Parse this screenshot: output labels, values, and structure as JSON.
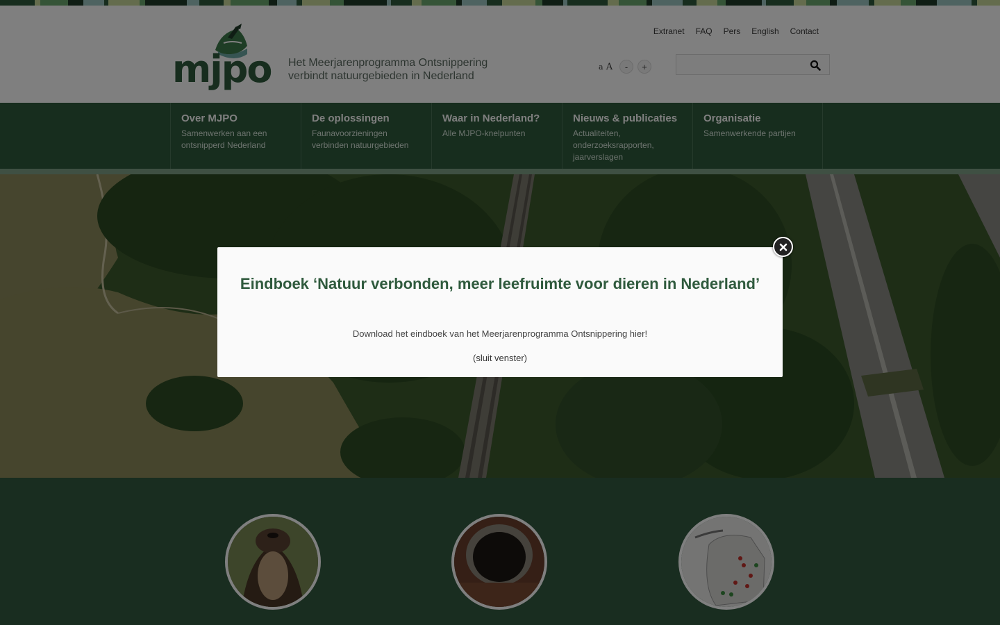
{
  "colors": {
    "brand_green": "#2f5a3d",
    "nav_border": "#4d7459",
    "header_bg": "#ffffff",
    "modal_bg": "#fafafa",
    "stripe": [
      "#2f5a3d",
      "#6aa86e",
      "#9cc7c2",
      "#c8d89b",
      "#1f3a29"
    ]
  },
  "header": {
    "logo_text": "mjpo",
    "tagline_line1": "Het Meerjarenprogramma Ontsnippering",
    "tagline_line2": "verbindt natuurgebieden in Nederland",
    "top_links": [
      "Extranet",
      "FAQ",
      "Pers",
      "English",
      "Contact"
    ],
    "font_size_label_small": "a",
    "font_size_label_large": "A",
    "font_decrease": "-",
    "font_increase": "+",
    "search_placeholder": "",
    "search_icon": "search-icon"
  },
  "nav": {
    "items": [
      {
        "title": "Over MJPO",
        "subtitle": "Samenwerken aan een ontsnipperd Nederland"
      },
      {
        "title": "De oplossingen",
        "subtitle": "Faunavoorzieningen verbinden natuurgebieden"
      },
      {
        "title": "Waar in Nederland?",
        "subtitle": "Alle MJPO-knelpunten"
      },
      {
        "title": "Nieuws & publicaties",
        "subtitle": "Actualiteiten, onderzoeksrapporten, jaarverslagen"
      },
      {
        "title": "Organisatie",
        "subtitle": "Samenwerkende partijen"
      }
    ]
  },
  "hero": {
    "image": "aerial-wildlife-overpass"
  },
  "features": {
    "images": [
      "otter-photo",
      "culvert-tunnel-photo",
      "netherlands-map"
    ]
  },
  "modal": {
    "title": "Eindboek ‘Natuur verbonden, meer leefruimte voor dieren in Nederland’",
    "download_text": "Download het eindboek van het Meerjarenprogramma Ontsnippering hier!",
    "close_text": "(sluit venster)",
    "close_icon": "close-icon"
  }
}
